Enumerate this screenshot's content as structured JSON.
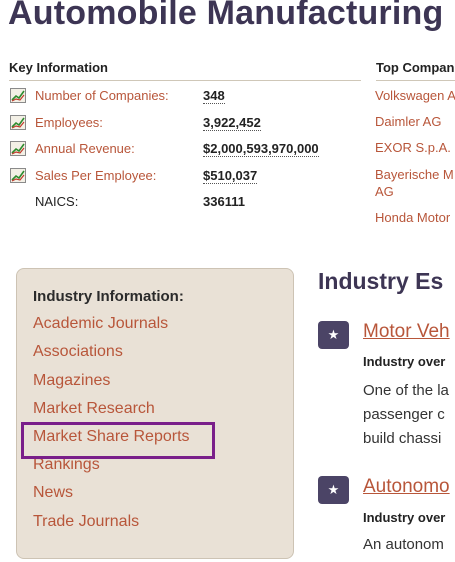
{
  "page": {
    "title": "Automobile Manufacturing"
  },
  "key_info": {
    "heading": "Key Information",
    "stats": [
      {
        "label": "Number of Companies:",
        "value": "348"
      },
      {
        "label": "Employees:",
        "value": "3,922,452"
      },
      {
        "label": "Annual Revenue:",
        "value": "$2,000,593,970,000"
      },
      {
        "label": "Sales Per Employee:",
        "value": "$510,037"
      }
    ],
    "naics_label": "NAICS:",
    "naics_value": "336111"
  },
  "top_companies": {
    "heading": "Top Compan",
    "items": [
      "Volkswagen A",
      "Daimler AG",
      "EXOR S.p.A.",
      "Bayerische M",
      "AG",
      "Honda Motor"
    ]
  },
  "industry_info": {
    "heading": "Industry Information:",
    "links": [
      "Academic Journals",
      "Associations",
      "Magazines",
      "Market Research",
      "Market Share Reports",
      "Rankings",
      "News",
      "Trade Journals"
    ]
  },
  "estimates": {
    "heading": "Industry Es",
    "articles": [
      {
        "title": "Motor Veh",
        "overview_label": "Industry over",
        "lines": [
          "One of the la",
          "passenger c",
          "build chassi"
        ]
      },
      {
        "title": "Autonomo",
        "overview_label": "Industry over",
        "lines": [
          "An autonom"
        ]
      }
    ]
  },
  "icons": {
    "stat_icon": "trend-chart-icon",
    "badge_icon": "star-icon"
  },
  "colors": {
    "link": "#b8563a",
    "title": "#3d3554",
    "panel_bg": "#e9e1d6",
    "highlight": "#7a1f8a",
    "badge_bg": "#4b4466"
  }
}
